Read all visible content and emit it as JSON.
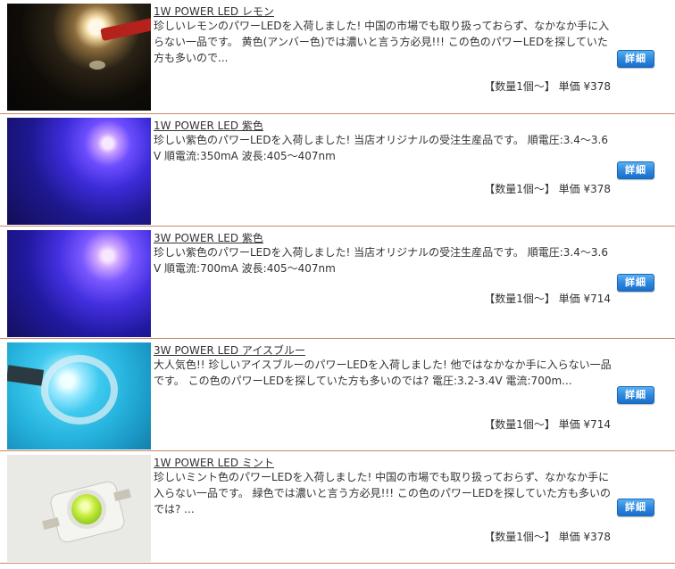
{
  "detail_label": "詳細",
  "items": [
    {
      "title": "1W POWER LED レモン",
      "description": "珍しいレモンのパワーLEDを入荷しました! 中国の市場でも取り扱っておらず、なかなか手に入らない一品です。 黄色(アンバー色)では濃いと言う方必見!!! この色のパワーLEDを探していた方も多いので...",
      "price": "【数量1個～】 単価 ¥378",
      "thumbnail": "lemon-led-photo"
    },
    {
      "title": "1W POWER LED 紫色",
      "description": "珍しい紫色のパワーLEDを入荷しました! 当店オリジナルの受注生産品です。 順電圧:3.4～3.6V 順電流:350mA 波長:405～407nm",
      "price": "【数量1個～】 単価 ¥378",
      "thumbnail": "purple-led-photo"
    },
    {
      "title": "3W POWER LED 紫色",
      "description": "珍しい紫色のパワーLEDを入荷しました! 当店オリジナルの受注生産品です。 順電圧:3.4～3.6V 順電流:700mA 波長:405～407nm",
      "price": "【数量1個～】 単価 ¥714",
      "thumbnail": "purple-led-photo"
    },
    {
      "title": "3W POWER LED アイスブルー",
      "description": "大人気色!! 珍しいアイスブルーのパワーLEDを入荷しました! 他ではなかなか手に入らない一品です。 この色のパワーLEDを探していた方も多いのでは? 電圧:3.2-3.4V 電流:700m...",
      "price": "【数量1個～】 単価 ¥714",
      "thumbnail": "ice-blue-led-photo"
    },
    {
      "title": "1W POWER LED ミント",
      "description": "珍しいミント色のパワーLEDを入荷しました! 中国の市場でも取り扱っておらず、なかなか手に入らない一品です。 緑色では濃いと言う方必見!!! この色のパワーLEDを探していた方も多いのでは? ...",
      "price": "【数量1個～】 単価 ¥378",
      "thumbnail": "mint-led-photo"
    }
  ]
}
